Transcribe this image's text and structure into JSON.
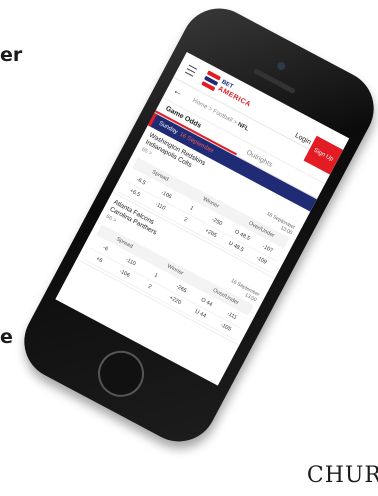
{
  "page_edge_text_top": "er",
  "page_edge_text_bottom": "e",
  "brand_corner": "CHUR",
  "header": {
    "logo_bet": "BET",
    "logo_america": "AMERICA",
    "login": "Login",
    "signup": "Sign Up"
  },
  "breadcrumb": {
    "home": "Home",
    "sep1": ">",
    "football": "Football",
    "sep2": ">",
    "current": "NFL"
  },
  "tabs": [
    "Game Odds",
    "Outrights"
  ],
  "day": {
    "label": "Sunday",
    "date": "16 September"
  },
  "events": [
    {
      "teams": "Washington Redskins\nIndianapolis Colts",
      "more": "65 >",
      "date": "16 September",
      "time": "13:00",
      "headers": [
        "Spread",
        "Winner",
        "Over/Under"
      ],
      "rows": [
        [
          "-6.5",
          "-106",
          "1",
          "-250",
          "O 48.5",
          "-107"
        ],
        [
          "+6.5",
          "-110",
          "2",
          "+205",
          "U 48.5",
          "-109"
        ]
      ]
    },
    {
      "teams": "Atlanta Falcons\nCarolina Panthers",
      "more": "66 >",
      "date": "16 September",
      "time": "13:00",
      "headers": [
        "Spread",
        "Winner",
        "Over/Under"
      ],
      "rows": [
        [
          "-6",
          "-110",
          "1",
          "-265",
          "O 44",
          "-111"
        ],
        [
          "+6",
          "-106",
          "2",
          "+220",
          "U 44",
          "-105"
        ]
      ]
    }
  ],
  "colors": {
    "brand_red": "#e31b23",
    "brand_navy": "#1f2b74"
  }
}
